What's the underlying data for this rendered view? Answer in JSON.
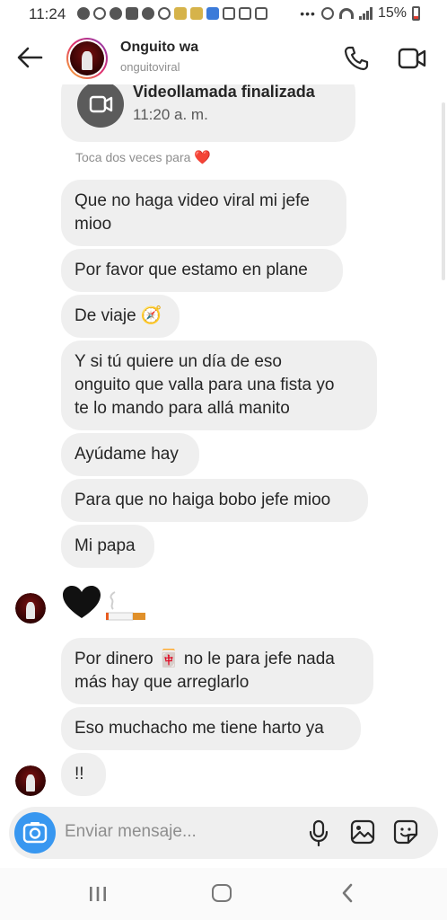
{
  "status_bar": {
    "time": "11:24",
    "battery": "15%",
    "dots": "•••"
  },
  "header": {
    "name": "Onguito wa",
    "username": "onguitoviral"
  },
  "call_card": {
    "title": "Videollamada finalizada",
    "time": "11:20 a. m."
  },
  "hint": {
    "text": "Toca dos veces para",
    "emoji": "❤️"
  },
  "messages": [
    {
      "line1": "Que no haga video viral mi jefe",
      "line2": "mioo"
    },
    {
      "text": "Por favor que estamo en plane"
    },
    {
      "text": "De viaje 🧭"
    },
    {
      "line1": "Y si tú quiere un día de eso",
      "line2": "onguito que valla para una fista yo",
      "line3": "te lo mando para allá manito"
    },
    {
      "text": "Ayúdame hay"
    },
    {
      "text": "Para que no haiga bobo jefe mioo"
    },
    {
      "text": "Mi papa"
    },
    {
      "line1": "Por dinero 🀄 no le para jefe nada",
      "line2": "más hay que arreglarlo"
    },
    {
      "text": "Eso muchacho me tiene harto ya"
    },
    {
      "text": "!!"
    }
  ],
  "composer": {
    "placeholder": "Enviar mensaje..."
  },
  "colors": {
    "bubble": "#efefef",
    "camera": "#3897f0",
    "text": "#262626",
    "muted": "#8e8e8e"
  }
}
